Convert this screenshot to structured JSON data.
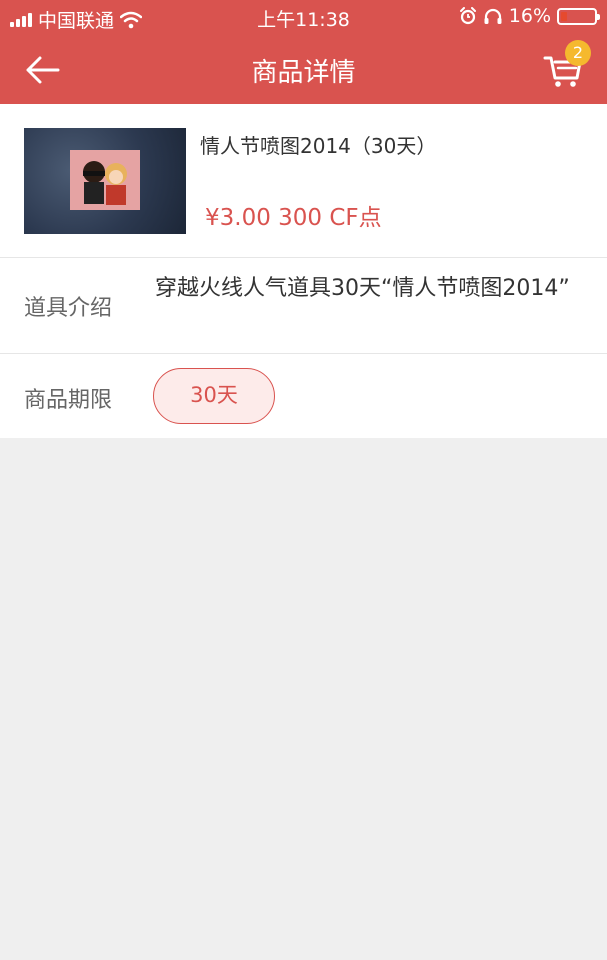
{
  "status_bar": {
    "carrier": "中国联通",
    "time": "上午11:38",
    "battery": "16%"
  },
  "nav": {
    "title": "商品详情",
    "cart_count": "2"
  },
  "product": {
    "name": "情人节喷图2014（30天）",
    "price": "¥3.00  300 CF点"
  },
  "details": {
    "desc_label": "道具介绍",
    "desc_text": "穿越火线人气道具30天“情人节喷图2014”",
    "period_label": "商品期限",
    "period_value": "30天"
  },
  "colors": {
    "accent": "#d9534f",
    "badge": "#f5b92e",
    "background": "#efefef"
  }
}
